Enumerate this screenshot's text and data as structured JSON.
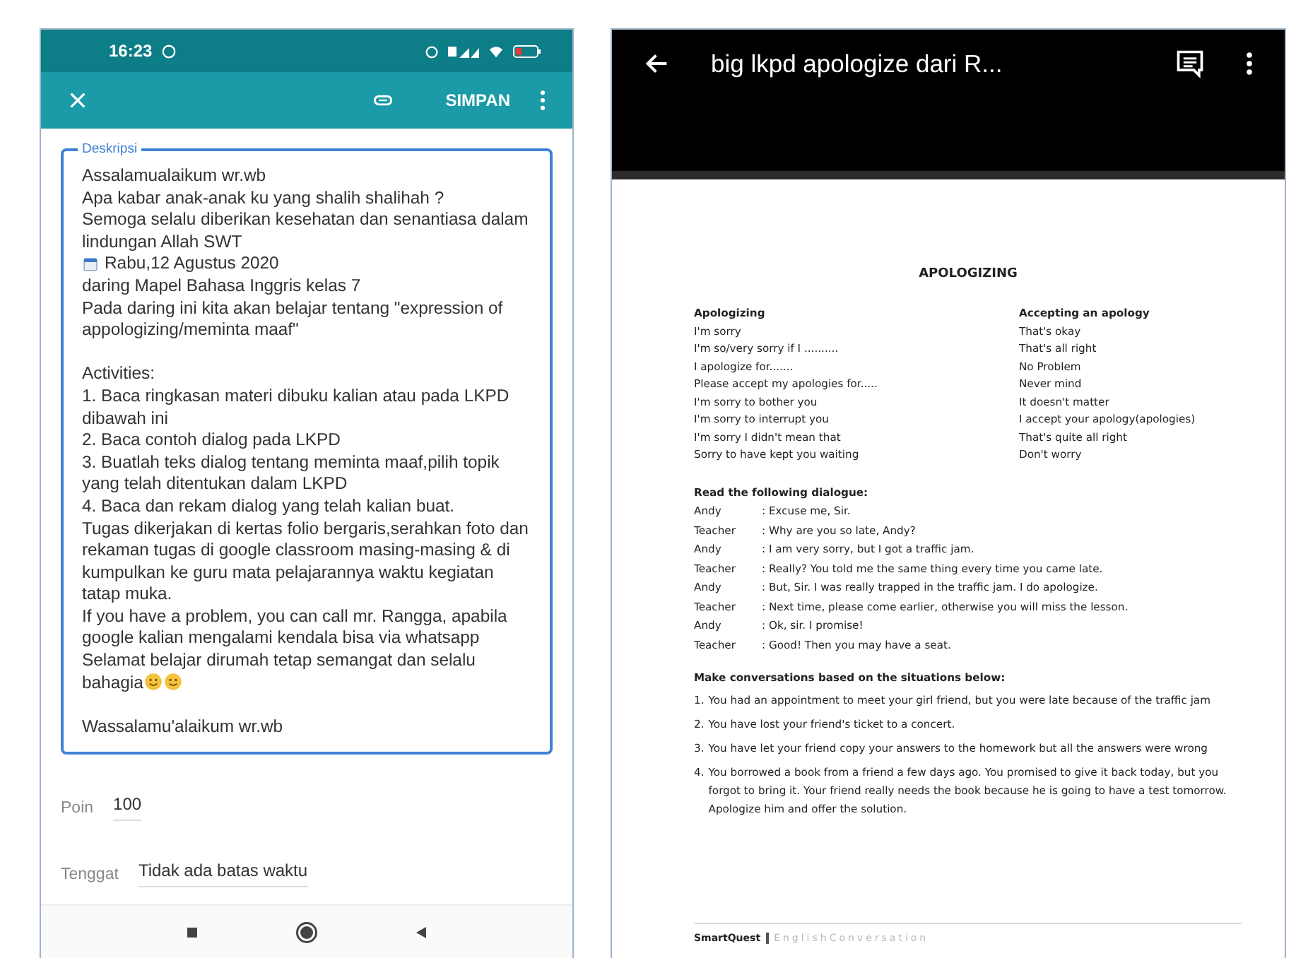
{
  "left_phone": {
    "status_bar": {
      "time": "16:23"
    },
    "app_bar": {
      "save": "SIMPAN"
    },
    "description": {
      "label": "Deskripsi",
      "blocks": [
        {
          "kind": "text",
          "text": "Assalamualaikum wr.wb\nApa kabar anak-anak ku yang shalih shalihah ?\nSemoga selalu diberikan kesehatan dan senantiasa dalam lindungan Allah SWT\n"
        },
        {
          "kind": "event",
          "text": "Rabu,12 Agustus 2020"
        },
        {
          "kind": "text",
          "text": "daring Mapel Bahasa Inggris kelas 7\nPada daring ini kita akan belajar tentang \"expression of appologizing/meminta maaf\"\n\n"
        },
        {
          "kind": "text",
          "text": "Activities:\n1. Baca ringkasan materi dibuku kalian atau pada LKPD dibawah ini\n2. Baca contoh dialog pada LKPD\n3. Buatlah teks dialog tentang meminta maaf,pilih topik yang telah ditentukan dalam LKPD\n4. Baca dan rekam dialog yang telah kalian buat.\n"
        },
        {
          "kind": "text",
          "text": "Tugas dikerjakan di kertas folio bergaris,serahkan foto dan rekaman tugas di google classroom masing-masing & di kumpulkan ke guru mata pelajarannya waktu kegiatan tatap muka.\n"
        },
        {
          "kind": "text",
          "text": "If you have a problem, you can call mr. Rangga, apabila google kalian mengalami kendala bisa via whatsapp"
        },
        {
          "kind": "smiley_end",
          "text": "Selamat belajar dirumah tetap semangat dan selalu bahagia"
        },
        {
          "kind": "text",
          "text": "\nWassalamu'alaikum wr.wb"
        }
      ]
    },
    "fields": [
      {
        "label": "Poin",
        "value": "100"
      },
      {
        "label": "Tenggat",
        "value": "Tidak ada batas waktu"
      }
    ]
  },
  "right_phone": {
    "title": "big lkpd apologize dari R...",
    "document": {
      "title": "APOLOGIZING",
      "columns": [
        {
          "heading": "Apologizing",
          "items": [
            "I'm sorry",
            "I'm so/very sorry if I ..........",
            "I apologize for.......",
            "Please accept my apologies for.....",
            "I'm sorry to bother you",
            "I'm sorry to interrupt you",
            "I'm sorry I didn't mean that",
            "Sorry to have kept you waiting"
          ]
        },
        {
          "heading": "Accepting an apology",
          "items": [
            "That's okay",
            "That's all right",
            "No Problem",
            "Never mind",
            "It doesn't matter",
            "I accept your apology(apologies)",
            "That's quite all right",
            "Don't worry"
          ]
        }
      ],
      "dialogue_heading": "Read the following dialogue:",
      "dialogue": [
        {
          "speaker": "Andy",
          "line": ": Excuse me, Sir."
        },
        {
          "speaker": "Teacher",
          "line": ": Why are you so late, Andy?"
        },
        {
          "speaker": "Andy",
          "line": ": I am very sorry, but I got a traffic jam."
        },
        {
          "speaker": "Teacher",
          "line": ": Really? You told me the same thing every time you came late."
        },
        {
          "speaker": "Andy",
          "line": ": But, Sir. I was really trapped in the traffic jam. I do apologize."
        },
        {
          "speaker": "Teacher",
          "line": ": Next time, please come earlier, otherwise you will miss the lesson."
        },
        {
          "speaker": "Andy",
          "line": ": Ok, sir. I promise!"
        },
        {
          "speaker": "Teacher",
          "line": ": Good! Then you may have a seat."
        }
      ],
      "tasks_heading": "Make conversations based on the situations below:",
      "tasks": [
        {
          "number": "1.",
          "text": "You had an appointment to meet your girl friend, but you were late because of the traffic jam"
        },
        {
          "number": "2.",
          "text": "You have lost your friend's ticket to a concert."
        },
        {
          "number": "3.",
          "text": "You have let your friend copy your answers to the homework but all the answers were wrong"
        },
        {
          "number": "4.",
          "text": "You borrowed a book from a friend a few days ago. You promised to give it back today, but you forgot to bring it. Your friend really needs the book because he is going to have a test tomorrow. Apologize him and offer the solution."
        }
      ],
      "footer": {
        "brand": "SmartQuest",
        "subtitle": "EnglishConversation"
      }
    }
  }
}
